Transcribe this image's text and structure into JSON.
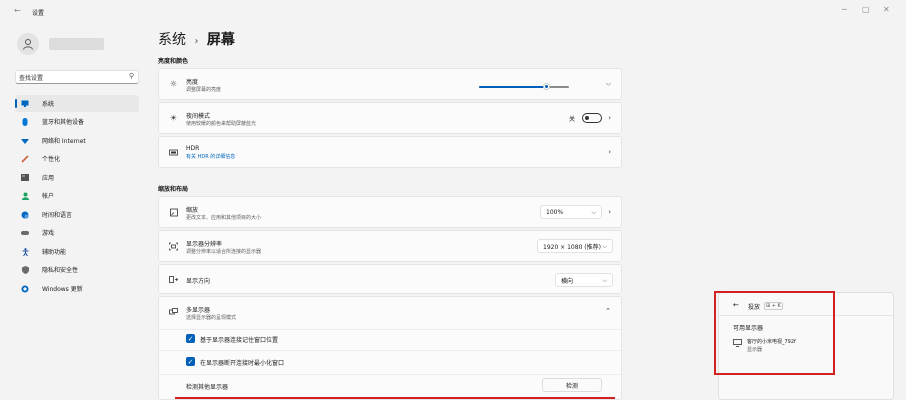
{
  "window": {
    "title": "设置",
    "back_icon": "back-arrow-icon",
    "controls": [
      "─",
      "▢",
      "✕"
    ]
  },
  "user": {
    "avatar_icon": "person-icon"
  },
  "search": {
    "value": "查找设置",
    "icon": "search-icon"
  },
  "sidebar": {
    "items": [
      {
        "label": "系统",
        "icon": "monitor-icon",
        "color": "#0067c0",
        "selected": true
      },
      {
        "label": "蓝牙和其他设备",
        "icon": "bluetooth-icon",
        "color": "#0078d4"
      },
      {
        "label": "网络和 Internet",
        "icon": "wifi-icon",
        "color": "#0067c0"
      },
      {
        "label": "个性化",
        "icon": "brush-icon",
        "color": "#c8623a"
      },
      {
        "label": "应用",
        "icon": "apps-icon",
        "color": "#6a6a6a"
      },
      {
        "label": "帐户",
        "icon": "account-icon",
        "color": "#1aa260"
      },
      {
        "label": "时间和语言",
        "icon": "globe-clock-icon",
        "color": "#0067c0"
      },
      {
        "label": "游戏",
        "icon": "gamepad-icon",
        "color": "#6a6a6a"
      },
      {
        "label": "辅助功能",
        "icon": "accessibility-icon",
        "color": "#1a4fa0"
      },
      {
        "label": "隐私和安全性",
        "icon": "shield-icon",
        "color": "#6a6a6a"
      },
      {
        "label": "Windows 更新",
        "icon": "update-icon",
        "color": "#0067c0"
      }
    ]
  },
  "breadcrumb": {
    "parent": "系统",
    "separator": "›",
    "current": "屏幕"
  },
  "sections": {
    "brightness_color": "亮度和颜色",
    "scale_layout": "缩放和布局"
  },
  "cards": {
    "brightness": {
      "title": "亮度",
      "subtitle": "调整屏幕的亮度",
      "value": 0.75,
      "icon": "sun-icon"
    },
    "night_light": {
      "title": "夜间模式",
      "subtitle": "使用较暖的颜色来帮助屏蔽蓝光",
      "state": "关",
      "icon": "sun-moon-icon"
    },
    "hdr": {
      "title": "HDR",
      "subtitle": "有关 HDR 的详细信息",
      "icon": "hdr-icon"
    },
    "scale": {
      "title": "缩放",
      "subtitle": "更改文本、应用和其他项目的大小",
      "value": "100%",
      "icon": "scale-icon"
    },
    "resolution": {
      "title": "显示器分辨率",
      "subtitle": "调整分辨率以适合所连接的显示器",
      "value": "1920 × 1080 (推荐)",
      "icon": "resolution-icon"
    },
    "orientation": {
      "title": "显示方向",
      "value": "横向",
      "icon": "rotate-icon"
    },
    "multi_display": {
      "title": "多显示器",
      "subtitle": "选择显示器的呈现模式",
      "icon": "multi-display-icon"
    },
    "remember_position": {
      "label": "基于显示器连接记住窗口位置",
      "checked": true
    },
    "minimize_windows": {
      "label": "在显示器断开连接时最小化窗口",
      "checked": true
    },
    "detect": {
      "label": "检测其他显示器",
      "button": "检测"
    }
  },
  "cast": {
    "back_icon": "back-arrow-icon",
    "title": "投放",
    "shortcut": "⊞ + K",
    "available_label": "可用显示器",
    "devices": [
      {
        "name": "客厅的小米电视_792f",
        "type": "显示器",
        "icon": "display-icon"
      }
    ]
  },
  "colors": {
    "accent": "#005fb8",
    "highlight_box": "#d32020"
  }
}
